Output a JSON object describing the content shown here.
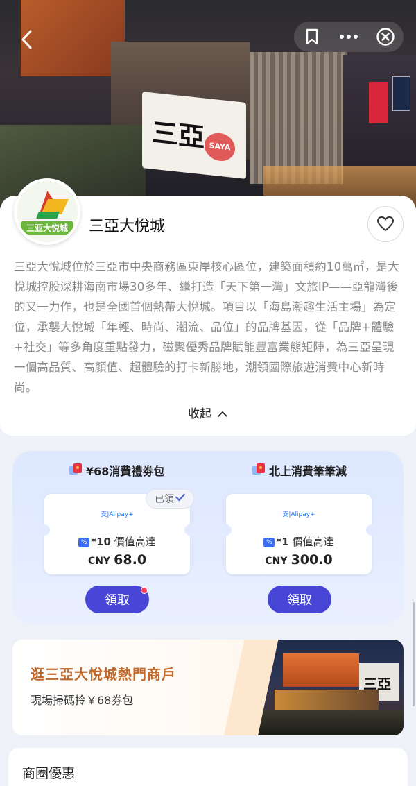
{
  "topbar": {
    "back_icon": "chevron-left-icon",
    "bookmark_icon": "bookmark-icon",
    "more_icon": "more-dots-icon",
    "close_icon": "close-circle-icon"
  },
  "hero": {
    "screen_text": "三亞",
    "heart_text": "SAYA"
  },
  "mall": {
    "logo_text": "三亚大悦城",
    "name": "三亞大悅城",
    "favorite_icon": "heart-icon",
    "description": "三亞大悅城位於三亞市中央商務區東岸核心區位，建築面積約10萬㎡，是大悅城控股深耕海南市場30多年、繼打造「天下第一灣」文旅IP——亞龍灣後的又一力作，也是全國首個熱帶大悅城。項目以「海島潮趣生活主場」為定位，承襲大悅城「年輕、時尚、潮流、品位」的品牌基因，從「品牌+體驗+社交」等多角度重點發力，磁聚優秀品牌賦能豐富業態矩陣，為三亞呈現一個高品質、高顏值、超體驗的打卡新勝地，潮領國際旅遊消費中心新時尚。",
    "collapse_label": "收起"
  },
  "coupons": [
    {
      "title": "¥68消費禮劵包",
      "provider": "Alipay+",
      "multiplier": "*10",
      "value_label": "價值高達",
      "currency": "CNY",
      "amount": "68.0",
      "status": "已領",
      "button": "領取"
    },
    {
      "title": "北上消費筆筆減",
      "provider": "Alipay+",
      "multiplier": "*1",
      "value_label": "價值高達",
      "currency": "CNY",
      "amount": "300.0",
      "button": "領取"
    }
  ],
  "banner": {
    "title": "逛三亞大悅城熱門商戶",
    "subtitle": "現場掃碼拎￥68券包",
    "image_text": "三亞"
  },
  "section": {
    "title": "商圈優惠"
  },
  "colors": {
    "accent": "#4746d6",
    "banner_title": "#c2692c",
    "badge_dot": "#ff3b55"
  }
}
